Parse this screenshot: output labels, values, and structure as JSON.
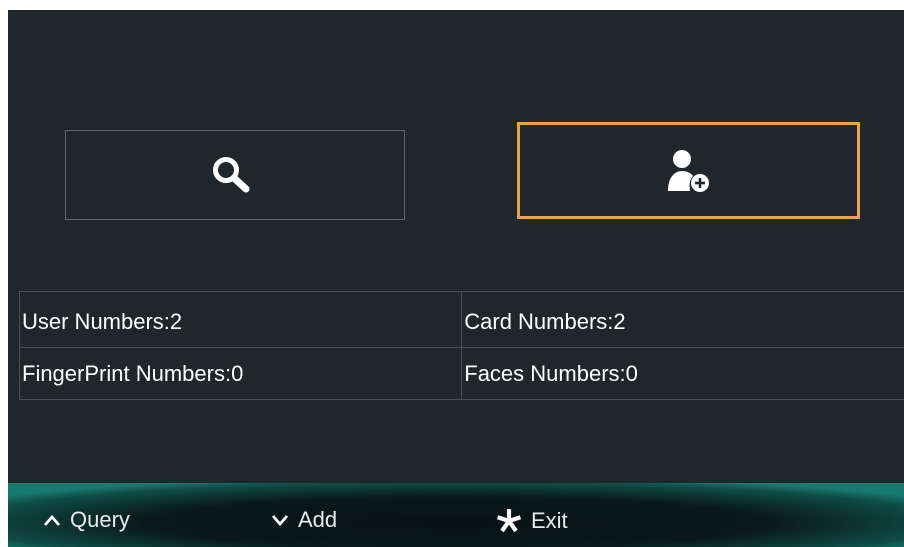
{
  "actions": {
    "query": {
      "icon": "search-icon"
    },
    "add": {
      "icon": "add-user-icon",
      "selected": true,
      "accent": "#f0a04b"
    }
  },
  "stats": {
    "user_numbers": "User Numbers:2",
    "card_numbers": "Card Numbers:2",
    "fingerprint_numbers": "FingerPrint Numbers:0",
    "faces_numbers": "Faces Numbers:0"
  },
  "footer": {
    "query": {
      "icon": "chevron-up-icon",
      "label": "Query"
    },
    "add": {
      "icon": "chevron-down-icon",
      "label": "Add"
    },
    "exit": {
      "icon": "asterisk-icon",
      "label": "Exit"
    }
  },
  "colors": {
    "background": "#1f272c",
    "border": "#5d666b",
    "text": "#ffffff",
    "footer_glow": "#177a70"
  }
}
